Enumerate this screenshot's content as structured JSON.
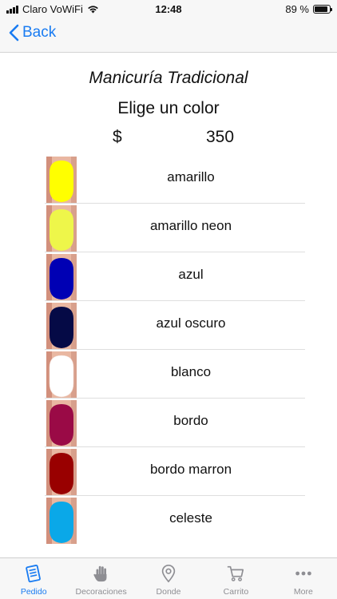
{
  "status_bar": {
    "carrier": "Claro VoWiFi",
    "time": "12:48",
    "battery": "89 %",
    "battery_level": 0.89
  },
  "nav": {
    "back_label": "Back"
  },
  "header": {
    "title": "Manicuría Tradicional",
    "subtitle": "Elige un color",
    "currency": "$",
    "price": "350"
  },
  "colors": [
    {
      "name": "amarillo",
      "hex": "#ffff00"
    },
    {
      "name": "amarillo neon",
      "hex": "#eef64a"
    },
    {
      "name": "azul",
      "hex": "#0000b4"
    },
    {
      "name": "azul oscuro",
      "hex": "#050a46"
    },
    {
      "name": "blanco",
      "hex": "#ffffff"
    },
    {
      "name": "bordo",
      "hex": "#9a0a46"
    },
    {
      "name": "bordo  marron",
      "hex": "#990000"
    },
    {
      "name": "celeste",
      "hex": "#0aa8e8"
    }
  ],
  "tabs": [
    {
      "label": "Pedido",
      "icon": "order-list-icon",
      "active": true
    },
    {
      "label": "Decoraciones",
      "icon": "hand-icon",
      "active": false
    },
    {
      "label": "Donde",
      "icon": "location-pin-icon",
      "active": false
    },
    {
      "label": "Carrito",
      "icon": "cart-icon",
      "active": false
    },
    {
      "label": "More",
      "icon": "more-dots-icon",
      "active": false
    }
  ]
}
